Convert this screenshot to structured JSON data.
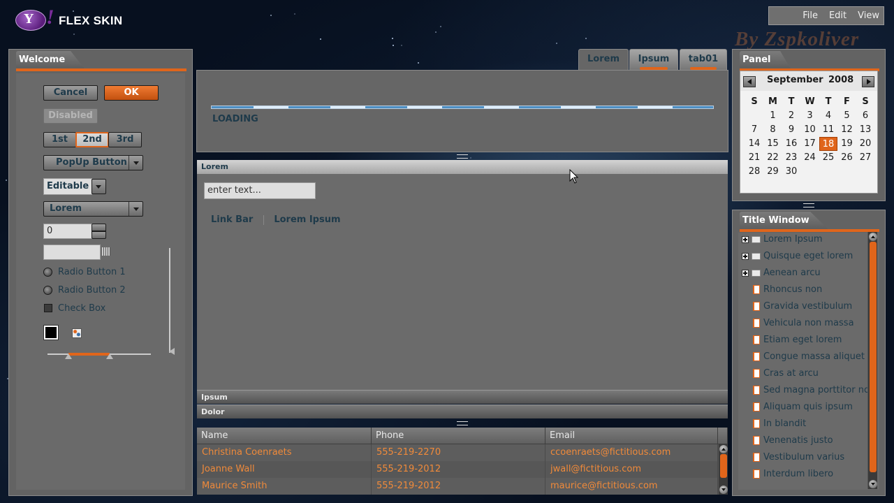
{
  "app": {
    "name": "FLEX SKIN",
    "logo_text": "Y!",
    "watermark": "By Zspkoliver"
  },
  "menubar": {
    "items": [
      "File",
      "Edit",
      "View"
    ]
  },
  "welcome_panel": {
    "title": "Welcome",
    "cancel": "Cancel",
    "ok": "OK",
    "disabled": "Disabled",
    "segments": [
      "1st",
      "2nd",
      "3rd"
    ],
    "popup_button": "PopUp Button",
    "combo_editable": "Editable",
    "combo_select": "Lorem",
    "stepper_value": "0",
    "radio1": "Radio Button 1",
    "radio2": "Radio Button 2",
    "checkbox": "Check Box",
    "color_black": "#000000",
    "slider_range": [
      0.2,
      0.6
    ],
    "vslider_value": 0.0
  },
  "tabs": [
    "Lorem",
    "Ipsum",
    "tab01"
  ],
  "loading": {
    "label": "LOADING"
  },
  "accordion": {
    "section1": "Lorem",
    "text_input_placeholder": "enter text...",
    "linkbar": [
      "Link Bar",
      "Lorem Ipsum"
    ],
    "section2": "Ipsum",
    "section3": "Dolor"
  },
  "grid": {
    "columns": [
      "Name",
      "Phone",
      "Email"
    ],
    "rows": [
      [
        "Christina Coenraets",
        "555-219-2270",
        "ccoenraets@fictitious.com"
      ],
      [
        "Joanne Wall",
        "555-219-2012",
        "jwall@fictitious.com"
      ],
      [
        "Maurice Smith",
        "555-219-2012",
        "maurice@fictitious.com"
      ]
    ]
  },
  "calendar_panel": {
    "title": "Panel",
    "month": "September",
    "year": "2008",
    "weekdays": [
      "S",
      "M",
      "T",
      "W",
      "T",
      "F",
      "S"
    ],
    "first_weekday_index": 1,
    "days_in_month": 30,
    "selected_day": 18
  },
  "title_window": {
    "title": "Title Window",
    "folders": [
      "Lorem Ipsum",
      "Quisque eget lorem",
      "Aenean arcu"
    ],
    "items": [
      "Rhoncus non",
      "Gravida vestibulum",
      "Vehicula non massa",
      "Etiam eget lorem",
      "Congue massa aliquet s",
      "Cras at arcu",
      "Sed magna porttitor no",
      "Aliquam quis ipsum",
      "In blandit",
      "Venenatis justo",
      "Vestibulum varius",
      "Interdum libero"
    ]
  },
  "colors": {
    "accent": "#e0651b",
    "panel": "#636363",
    "text": "#1e3a4a",
    "grid_text": "#f08a3a"
  }
}
